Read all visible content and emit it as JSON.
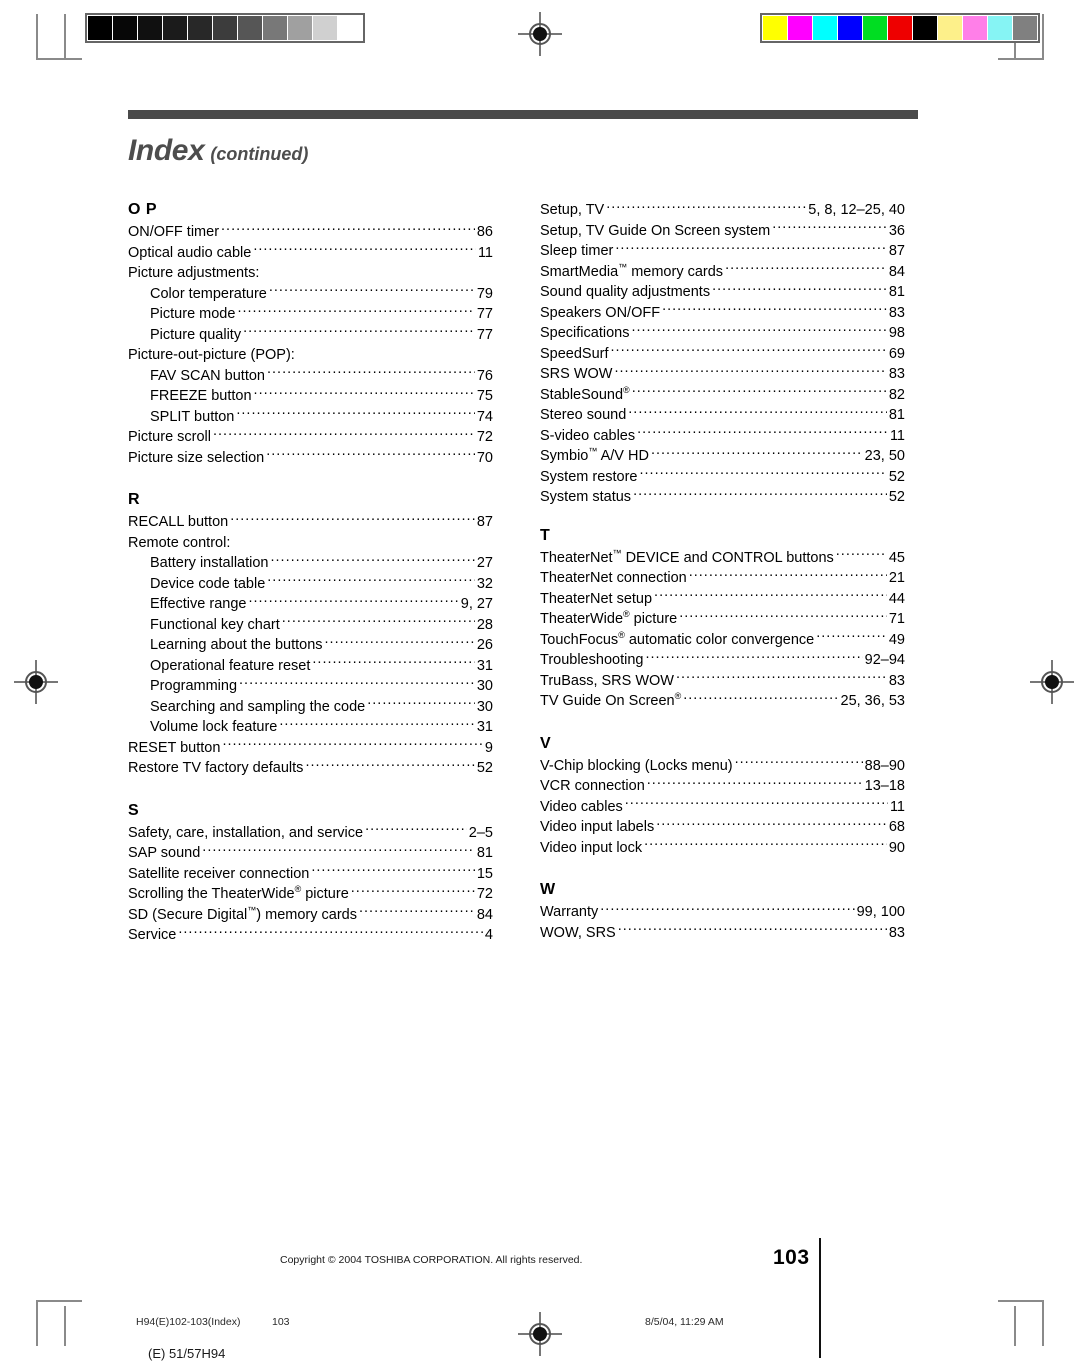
{
  "page": {
    "title_main": "Index",
    "title_sub": "(continued)",
    "folio": "103",
    "copyright": "Copyright © 2004 TOSHIBA CORPORATION. All rights reserved."
  },
  "print_slug": {
    "file": "H94(E)102-103(Index)",
    "page": "103",
    "date": "8/5/04, 11:29 AM",
    "model": "(E) 51/57H94"
  },
  "calibration": {
    "gray_strip": [
      "#000000",
      "#070707",
      "#101010",
      "#1b1b1b",
      "#282828",
      "#3c3c3c",
      "#565656",
      "#787878",
      "#a0a0a0",
      "#d0d0d0",
      "#ffffff"
    ],
    "color_strip": [
      "#ffff00",
      "#ff00ff",
      "#00ffff",
      "#0000ff",
      "#00dd22",
      "#ee0000",
      "#000000",
      "#fdf08a",
      "#ff7fe8",
      "#86f4f4",
      "#808080"
    ]
  },
  "columns": {
    "left": [
      {
        "letter": "O P",
        "entries": [
          {
            "label": "ON/OFF timer",
            "page": "86",
            "sub": false
          },
          {
            "label": "Optical audio cable",
            "page": "11",
            "sub": false
          },
          {
            "label": "Picture adjustments:",
            "page": "",
            "sub": false,
            "nodots": true
          },
          {
            "label": "Color temperature",
            "page": "79",
            "sub": true
          },
          {
            "label": "Picture mode",
            "page": "77",
            "sub": true
          },
          {
            "label": "Picture quality",
            "page": "77",
            "sub": true
          },
          {
            "label": "Picture-out-picture (POP):",
            "page": "",
            "sub": false,
            "nodots": true
          },
          {
            "label": "FAV SCAN button",
            "page": "76",
            "sub": true
          },
          {
            "label": "FREEZE button",
            "page": "75",
            "sub": true
          },
          {
            "label": "SPLIT button",
            "page": "74",
            "sub": true
          },
          {
            "label": "Picture scroll",
            "page": "72",
            "sub": false
          },
          {
            "label": "Picture size selection",
            "page": "70",
            "sub": false
          }
        ]
      },
      {
        "letter": "R",
        "entries": [
          {
            "label": "RECALL button",
            "page": "87",
            "sub": false
          },
          {
            "label": "Remote control:",
            "page": "",
            "sub": false,
            "nodots": true
          },
          {
            "label": "Battery installation",
            "page": "27",
            "sub": true
          },
          {
            "label": "Device code table",
            "page": "32",
            "sub": true
          },
          {
            "label": "Effective range",
            "page": "9, 27",
            "sub": true
          },
          {
            "label": "Functional key chart",
            "page": "28",
            "sub": true
          },
          {
            "label": "Learning about the buttons",
            "page": "26",
            "sub": true
          },
          {
            "label": "Operational feature reset",
            "page": "31",
            "sub": true
          },
          {
            "label": "Programming",
            "page": "30",
            "sub": true
          },
          {
            "label": "Searching and sampling the code",
            "page": "30",
            "sub": true
          },
          {
            "label": "Volume lock feature",
            "page": "31",
            "sub": true
          },
          {
            "label": "RESET button",
            "page": "9",
            "sub": false
          },
          {
            "label": "Restore TV factory defaults",
            "page": "52",
            "sub": false
          }
        ]
      },
      {
        "letter": "S",
        "entries": [
          {
            "label": "Safety, care, installation, and service",
            "page": "2–5",
            "sub": false
          },
          {
            "label": "SAP sound",
            "page": "81",
            "sub": false
          },
          {
            "label": "Satellite receiver connection",
            "page": "15",
            "sub": false
          },
          {
            "label": "Scrolling the TheaterWide® picture",
            "page": "72",
            "sub": false
          },
          {
            "label": "SD (Secure Digital™) memory cards",
            "page": "84",
            "sub": false
          },
          {
            "label": "Service",
            "page": "4",
            "sub": false
          }
        ]
      }
    ],
    "right": [
      {
        "letter": "",
        "entries": [
          {
            "label": "Setup, TV",
            "page": "5, 8, 12–25, 40",
            "sub": false
          },
          {
            "label": "Setup, TV Guide On Screen system",
            "page": "36",
            "sub": false
          },
          {
            "label": "Sleep timer",
            "page": "87",
            "sub": false
          },
          {
            "label": "SmartMedia™ memory cards",
            "page": "84",
            "sub": false
          },
          {
            "label": "Sound quality adjustments",
            "page": "81",
            "sub": false
          },
          {
            "label": "Speakers ON/OFF",
            "page": "83",
            "sub": false
          },
          {
            "label": "Specifications",
            "page": "98",
            "sub": false
          },
          {
            "label": "SpeedSurf",
            "page": "69",
            "sub": false
          },
          {
            "label": "SRS WOW",
            "page": "83",
            "sub": false
          },
          {
            "label": "StableSound®",
            "page": "82",
            "sub": false
          },
          {
            "label": "Stereo sound",
            "page": "81",
            "sub": false
          },
          {
            "label": "S-video cables",
            "page": "11",
            "sub": false
          },
          {
            "label": "Symbio™ A/V HD",
            "page": "23, 50",
            "sub": false
          },
          {
            "label": "System restore",
            "page": "52",
            "sub": false
          },
          {
            "label": "System status",
            "page": "52",
            "sub": false
          }
        ]
      },
      {
        "letter": "T",
        "entries": [
          {
            "label": "TheaterNet™ DEVICE and CONTROL buttons",
            "page": "45",
            "sub": false
          },
          {
            "label": "TheaterNet connection",
            "page": "21",
            "sub": false
          },
          {
            "label": "TheaterNet setup",
            "page": "44",
            "sub": false
          },
          {
            "label": "TheaterWide® picture",
            "page": "71",
            "sub": false
          },
          {
            "label": "TouchFocus® automatic color convergence",
            "page": "49",
            "sub": false
          },
          {
            "label": "Troubleshooting",
            "page": "92–94",
            "sub": false
          },
          {
            "label": "TruBass, SRS WOW",
            "page": "83",
            "sub": false
          },
          {
            "label": "TV Guide On Screen®",
            "page": "25, 36, 53",
            "sub": false
          }
        ]
      },
      {
        "letter": "V",
        "entries": [
          {
            "label": "V-Chip blocking (Locks menu)",
            "page": "88–90",
            "sub": false
          },
          {
            "label": "VCR connection",
            "page": "13–18",
            "sub": false
          },
          {
            "label": "Video cables",
            "page": "11",
            "sub": false
          },
          {
            "label": "Video input labels",
            "page": "68",
            "sub": false
          },
          {
            "label": "Video input lock",
            "page": "90",
            "sub": false
          }
        ]
      },
      {
        "letter": "W",
        "entries": [
          {
            "label": "Warranty",
            "page": "99, 100",
            "sub": false
          },
          {
            "label": "WOW, SRS",
            "page": "83",
            "sub": false
          }
        ]
      }
    ]
  }
}
